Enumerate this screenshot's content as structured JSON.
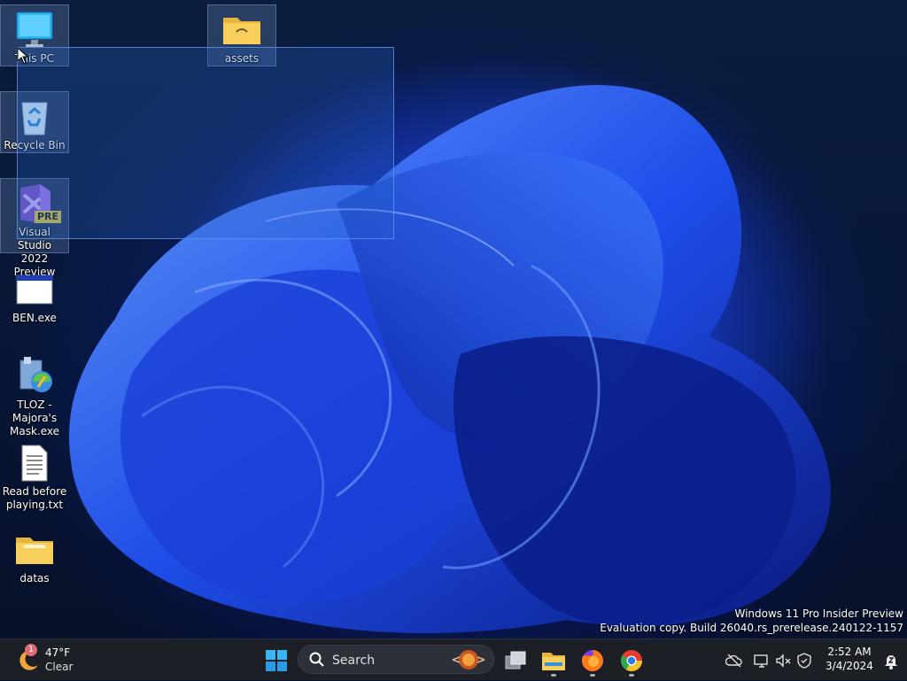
{
  "desktop": {
    "icons": [
      {
        "label": "This PC",
        "icon": "monitor-icon"
      },
      {
        "label": "assets",
        "icon": "folder-icon"
      },
      {
        "label": "Recycle Bin",
        "icon": "recycle-bin-icon"
      },
      {
        "label": "Visual Studio 2022 Preview",
        "icon": "visual-studio-icon",
        "badge": "PRE"
      },
      {
        "label": "BEN.exe",
        "icon": "window-app-icon"
      },
      {
        "label": "TLOZ - Majora's Mask.exe",
        "icon": "installer-icon"
      },
      {
        "label": "Read before playing.txt",
        "icon": "text-file-icon"
      },
      {
        "label": "datas",
        "icon": "folder-icon"
      }
    ],
    "watermark": {
      "line1": "Windows 11 Pro Insider Preview",
      "line2": "Evaluation copy. Build 26040.rs_prerelease.240122-1157"
    }
  },
  "taskbar": {
    "weather": {
      "temp": "47°F",
      "condition": "Clear",
      "badge": "1"
    },
    "search": {
      "placeholder": "Search"
    },
    "pinned": [
      "start-button",
      "task-view",
      "file-explorer",
      "firefox",
      "chrome"
    ],
    "clock": {
      "time": "2:52 AM",
      "date": "3/4/2024"
    }
  },
  "colors": {
    "accent": "#2a5dff",
    "taskbar": "#1c1f26",
    "selection": "#2864c8"
  }
}
